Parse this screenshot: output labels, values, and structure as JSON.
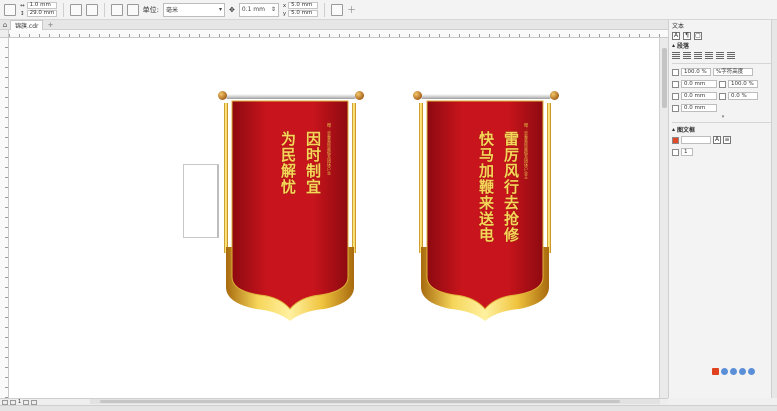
{
  "propbar": {
    "width_value": "1.0 mm",
    "height_value": "29.0 mm",
    "unit_label": "单位:",
    "unit_value": "毫米",
    "nudge_value": "0.1 mm",
    "dup_x": "5.0 mm",
    "dup_y": "5.0 mm"
  },
  "tabs": {
    "document": "锦旗.cdr"
  },
  "banners": [
    {
      "right_column": "因时制宜",
      "left_column": "为民解忧",
      "caption": "赠：忠泰装饰度假及团体户业"
    },
    {
      "right_column": "雷厉风行去抢修",
      "left_column": "快马加鞭来送电",
      "caption": "赠：忠泰装饰度假及团体户业主"
    }
  ],
  "docker": {
    "title": "文本",
    "section_paragraph": "段落",
    "first_indent": "100.0 %",
    "spacing_mode": "%字符高度",
    "left_indent": "0.0 mm",
    "line_spacing": "100.0 %",
    "right_indent": "0.0 mm",
    "char_spacing": "0.0 %",
    "space_before": "0.0 mm",
    "section_frame": "图文框",
    "columns": "1"
  },
  "pagebar": {
    "page_label": "1"
  },
  "colors": {
    "banner_red": "#b5121b",
    "banner_gold": "#e7b52a",
    "text_gold": "#f6d65a"
  }
}
